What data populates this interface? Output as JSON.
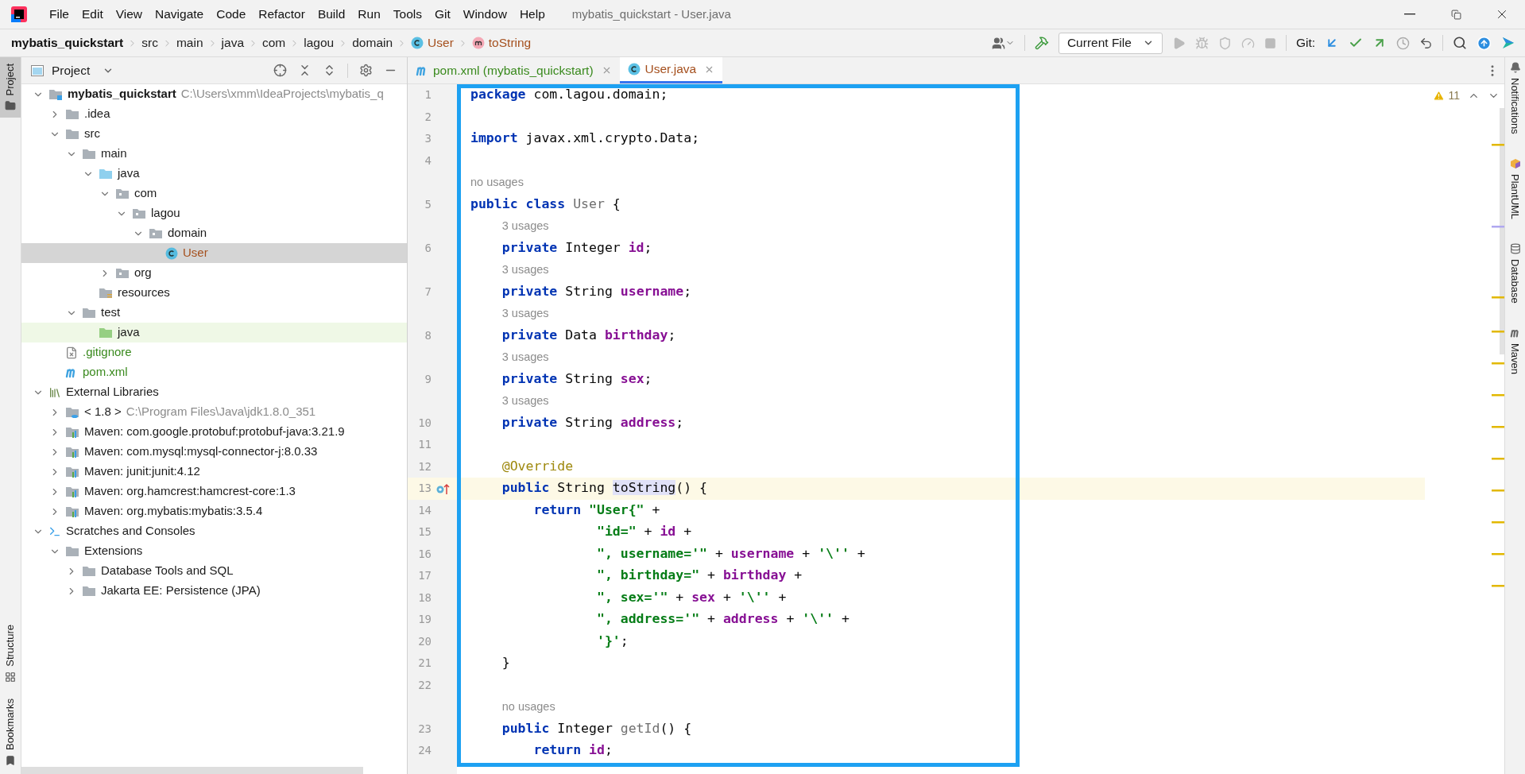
{
  "window": {
    "title": "mybatis_quickstart - User.java"
  },
  "menu": [
    "File",
    "Edit",
    "View",
    "Navigate",
    "Code",
    "Refactor",
    "Build",
    "Run",
    "Tools",
    "Git",
    "Window",
    "Help"
  ],
  "breadcrumbs": [
    {
      "kind": "project",
      "label": "mybatis_quickstart"
    },
    {
      "kind": "folder",
      "label": "src"
    },
    {
      "kind": "folder",
      "label": "main"
    },
    {
      "kind": "folder",
      "label": "java"
    },
    {
      "kind": "folder",
      "label": "com"
    },
    {
      "kind": "folder",
      "label": "lagou"
    },
    {
      "kind": "folder",
      "label": "domain"
    },
    {
      "kind": "class",
      "label": "User"
    },
    {
      "kind": "method",
      "label": "toString"
    }
  ],
  "toolbar": {
    "run_config": "Current File",
    "git_label": "Git:"
  },
  "left_strip": {
    "top": [
      {
        "kind": "project",
        "label": "Project",
        "selected": true
      }
    ],
    "bottom": [
      {
        "kind": "structure",
        "label": "Structure",
        "selected": false
      },
      {
        "kind": "bookmarks",
        "label": "Bookmarks",
        "selected": false
      }
    ]
  },
  "project_panel": {
    "title": "Project",
    "tree": [
      {
        "label": "mybatis_quickstart",
        "hint": "C:\\Users\\xmm\\IdeaProjects\\mybatis_q",
        "kind": "module",
        "expanded": true,
        "selected": false,
        "children": [
          {
            "label": ".idea",
            "kind": "folder",
            "expanded": false,
            "selected": false
          },
          {
            "label": "src",
            "kind": "folder",
            "expanded": true,
            "selected": false,
            "children": [
              {
                "label": "main",
                "kind": "folder",
                "expanded": true,
                "selected": false,
                "children": [
                  {
                    "label": "java",
                    "kind": "source",
                    "expanded": true,
                    "selected": false,
                    "children": [
                      {
                        "label": "com",
                        "kind": "package",
                        "expanded": true,
                        "selected": false,
                        "children": [
                          {
                            "label": "lagou",
                            "kind": "package",
                            "expanded": true,
                            "selected": false,
                            "children": [
                              {
                                "label": "domain",
                                "kind": "package",
                                "expanded": true,
                                "selected": false,
                                "children": [
                                  {
                                    "label": "User",
                                    "kind": "class",
                                    "color": "#a5501e",
                                    "selected": true
                                  }
                                ]
                              }
                            ]
                          }
                        ]
                      },
                      {
                        "label": "org",
                        "kind": "package",
                        "expanded": false,
                        "selected": false
                      }
                    ]
                  },
                  {
                    "label": "resources",
                    "kind": "resources",
                    "selected": false
                  }
                ]
              },
              {
                "label": "test",
                "kind": "folder",
                "expanded": true,
                "selected": false,
                "children": [
                  {
                    "label": "java",
                    "kind": "test",
                    "selected": false
                  }
                ]
              }
            ]
          },
          {
            "label": ".gitignore",
            "kind": "gitignore",
            "color": "#3a8a1e",
            "selected": false
          },
          {
            "label": "pom.xml",
            "kind": "maven",
            "color": "#3a8a1e",
            "selected": false
          }
        ]
      },
      {
        "label": "External Libraries",
        "kind": "libraries",
        "expanded": true,
        "selected": false,
        "children": [
          {
            "label": "< 1.8 >",
            "hint": "C:\\Program Files\\Java\\jdk1.8.0_351",
            "kind": "jdk",
            "expanded": false,
            "selected": false
          },
          {
            "label": "Maven: com.google.protobuf:protobuf-java:3.21.9",
            "kind": "library",
            "expanded": false,
            "selected": false
          },
          {
            "label": "Maven: com.mysql:mysql-connector-j:8.0.33",
            "kind": "library",
            "expanded": false,
            "selected": false
          },
          {
            "label": "Maven: junit:junit:4.12",
            "kind": "library",
            "expanded": false,
            "selected": false
          },
          {
            "label": "Maven: org.hamcrest:hamcrest-core:1.3",
            "kind": "library",
            "expanded": false,
            "selected": false
          },
          {
            "label": "Maven: org.mybatis:mybatis:3.5.4",
            "kind": "library",
            "expanded": false,
            "selected": false
          }
        ]
      },
      {
        "label": "Scratches and Consoles",
        "kind": "scratches",
        "expanded": true,
        "selected": false,
        "children": [
          {
            "label": "Extensions",
            "kind": "folder",
            "expanded": true,
            "selected": false,
            "children": [
              {
                "label": "Database Tools and SQL",
                "kind": "folder",
                "expanded": false,
                "selected": false
              },
              {
                "label": "Jakarta EE: Persistence (JPA)",
                "kind": "folder",
                "expanded": false,
                "selected": false
              }
            ]
          }
        ]
      }
    ]
  },
  "editor_tabs": [
    {
      "kind": "maven",
      "label": "pom.xml (mybatis_quickstart)",
      "color": "#3a8a1e",
      "selected": false
    },
    {
      "kind": "class",
      "label": "User.java",
      "color": "#a5501e",
      "selected": true
    }
  ],
  "editor": {
    "warnings": "11",
    "lines": [
      {
        "kind": "code",
        "number": "1",
        "current": false,
        "tokens": [
          {
            "kind": "keyword",
            "text": "package"
          },
          {
            "kind": "plain",
            "text": " com.lagou.domain;"
          }
        ]
      },
      {
        "kind": "code",
        "number": "2",
        "current": false
      },
      {
        "kind": "code",
        "number": "3",
        "current": false,
        "tokens": [
          {
            "kind": "keyword",
            "text": "import"
          },
          {
            "kind": "plain",
            "text": " javax.xml.crypto.Data;"
          }
        ]
      },
      {
        "kind": "code",
        "number": "4",
        "current": false
      },
      {
        "kind": "hint",
        "text": "no usages"
      },
      {
        "kind": "code",
        "number": "5",
        "current": false,
        "tokens": [
          {
            "kind": "keyword",
            "text": "public class "
          },
          {
            "kind": "unused",
            "text": "User"
          },
          {
            "kind": "plain",
            "text": " {"
          }
        ]
      },
      {
        "kind": "hint",
        "text": "3 usages"
      },
      {
        "kind": "code",
        "number": "6",
        "current": false,
        "tokens": [
          {
            "kind": "keyword",
            "text": "    private"
          },
          {
            "kind": "plain",
            "text": " Integer "
          },
          {
            "kind": "field",
            "text": "id"
          },
          {
            "kind": "plain",
            "text": ";"
          }
        ]
      },
      {
        "kind": "hint",
        "text": "3 usages"
      },
      {
        "kind": "code",
        "number": "7",
        "current": false,
        "tokens": [
          {
            "kind": "keyword",
            "text": "    private"
          },
          {
            "kind": "plain",
            "text": " String "
          },
          {
            "kind": "field",
            "text": "username"
          },
          {
            "kind": "plain",
            "text": ";"
          }
        ]
      },
      {
        "kind": "hint",
        "text": "3 usages"
      },
      {
        "kind": "code",
        "number": "8",
        "current": false,
        "tokens": [
          {
            "kind": "keyword",
            "text": "    private"
          },
          {
            "kind": "plain",
            "text": " Data "
          },
          {
            "kind": "field",
            "text": "birthday"
          },
          {
            "kind": "plain",
            "text": ";"
          }
        ]
      },
      {
        "kind": "hint",
        "text": "3 usages"
      },
      {
        "kind": "code",
        "number": "9",
        "current": false,
        "tokens": [
          {
            "kind": "keyword",
            "text": "    private"
          },
          {
            "kind": "plain",
            "text": " String "
          },
          {
            "kind": "field",
            "text": "sex"
          },
          {
            "kind": "plain",
            "text": ";"
          }
        ]
      },
      {
        "kind": "hint",
        "text": "3 usages"
      },
      {
        "kind": "code",
        "number": "10",
        "current": false,
        "tokens": [
          {
            "kind": "keyword",
            "text": "    private"
          },
          {
            "kind": "plain",
            "text": " String "
          },
          {
            "kind": "field",
            "text": "address"
          },
          {
            "kind": "plain",
            "text": ";"
          }
        ]
      },
      {
        "kind": "code",
        "number": "11",
        "current": false
      },
      {
        "kind": "code",
        "number": "12",
        "current": false,
        "tokens": [
          {
            "kind": "annotation",
            "text": "    @Override"
          }
        ]
      },
      {
        "kind": "code",
        "number": "13",
        "current": true,
        "override": true,
        "tokens": [
          {
            "kind": "keyword",
            "text": "    public"
          },
          {
            "kind": "plain",
            "text": " String "
          },
          {
            "kind": "marked",
            "text": "toString"
          },
          {
            "kind": "plain",
            "text": "() {"
          }
        ]
      },
      {
        "kind": "code",
        "number": "14",
        "current": false,
        "tokens": [
          {
            "kind": "keyword",
            "text": "        return "
          },
          {
            "kind": "string",
            "text": "\"User{\""
          },
          {
            "kind": "plain",
            "text": " +"
          }
        ]
      },
      {
        "kind": "code",
        "number": "15",
        "current": false,
        "tokens": [
          {
            "kind": "string",
            "text": "                \"id=\""
          },
          {
            "kind": "plain",
            "text": " + "
          },
          {
            "kind": "field",
            "text": "id"
          },
          {
            "kind": "plain",
            "text": " +"
          }
        ]
      },
      {
        "kind": "code",
        "number": "16",
        "current": false,
        "tokens": [
          {
            "kind": "string",
            "text": "                \", username='\""
          },
          {
            "kind": "plain",
            "text": " + "
          },
          {
            "kind": "field",
            "text": "username"
          },
          {
            "kind": "plain",
            "text": " + "
          },
          {
            "kind": "string",
            "text": "'\\''"
          },
          {
            "kind": "plain",
            "text": " +"
          }
        ]
      },
      {
        "kind": "code",
        "number": "17",
        "current": false,
        "tokens": [
          {
            "kind": "string",
            "text": "                \", birthday=\""
          },
          {
            "kind": "plain",
            "text": " + "
          },
          {
            "kind": "field",
            "text": "birthday"
          },
          {
            "kind": "plain",
            "text": " +"
          }
        ]
      },
      {
        "kind": "code",
        "number": "18",
        "current": false,
        "tokens": [
          {
            "kind": "string",
            "text": "                \", sex='\""
          },
          {
            "kind": "plain",
            "text": " + "
          },
          {
            "kind": "field",
            "text": "sex"
          },
          {
            "kind": "plain",
            "text": " + "
          },
          {
            "kind": "string",
            "text": "'\\''"
          },
          {
            "kind": "plain",
            "text": " +"
          }
        ]
      },
      {
        "kind": "code",
        "number": "19",
        "current": false,
        "tokens": [
          {
            "kind": "string",
            "text": "                \", address='\""
          },
          {
            "kind": "plain",
            "text": " + "
          },
          {
            "kind": "field",
            "text": "address"
          },
          {
            "kind": "plain",
            "text": " + "
          },
          {
            "kind": "string",
            "text": "'\\''"
          },
          {
            "kind": "plain",
            "text": " +"
          }
        ]
      },
      {
        "kind": "code",
        "number": "20",
        "current": false,
        "tokens": [
          {
            "kind": "string",
            "text": "                '}'"
          },
          {
            "kind": "plain",
            "text": ";"
          }
        ]
      },
      {
        "kind": "code",
        "number": "21",
        "current": false,
        "tokens": [
          {
            "kind": "plain",
            "text": "    }"
          }
        ]
      },
      {
        "kind": "code",
        "number": "22",
        "current": false
      },
      {
        "kind": "hint",
        "text": "no usages"
      },
      {
        "kind": "code",
        "number": "23",
        "current": false,
        "tokens": [
          {
            "kind": "keyword",
            "text": "    public"
          },
          {
            "kind": "plain",
            "text": " Integer "
          },
          {
            "kind": "unused",
            "text": "getId"
          },
          {
            "kind": "plain",
            "text": "() {"
          }
        ]
      },
      {
        "kind": "code",
        "number": "24",
        "current": false,
        "tokens": [
          {
            "kind": "keyword",
            "text": "        return "
          },
          {
            "kind": "field",
            "text": "id"
          },
          {
            "kind": "plain",
            "text": ";"
          }
        ]
      }
    ]
  },
  "right_strip": [
    {
      "kind": "notifications",
      "label": "Notifications"
    },
    {
      "kind": "plantuml",
      "label": "PlantUML"
    },
    {
      "kind": "database",
      "label": "Database"
    },
    {
      "kind": "maven",
      "label": "Maven"
    }
  ]
}
